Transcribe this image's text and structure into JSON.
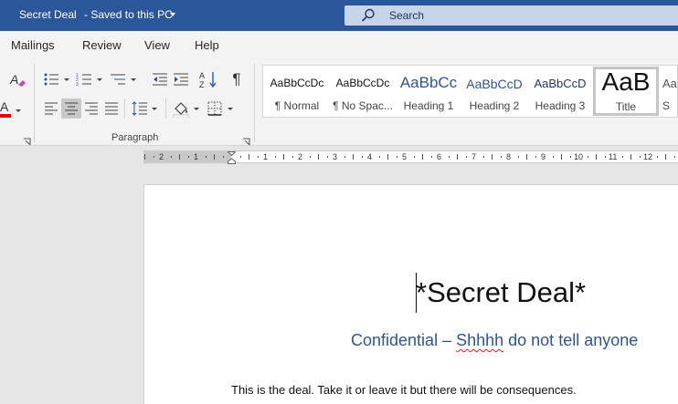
{
  "titlebar": {
    "doc_name": "Secret Deal",
    "save_status": "Saved to this PC",
    "search_label": "Search"
  },
  "tabs": [
    "Mailings",
    "Review",
    "View",
    "Help"
  ],
  "ribbon": {
    "paragraph_label": "Paragraph",
    "show_marks_glyph": "¶"
  },
  "styles": [
    {
      "preview": "AaBbCcDc",
      "name": "¶ Normal"
    },
    {
      "preview": "AaBbCcDc",
      "name": "¶ No Spac..."
    },
    {
      "preview": "AaBbCc",
      "name": "Heading 1"
    },
    {
      "preview": "AaBbCcD",
      "name": "Heading 2"
    },
    {
      "preview": "AaBbCcD",
      "name": "Heading 3"
    },
    {
      "preview": "AaB",
      "name": "Title"
    },
    {
      "preview": "Aa",
      "name": "S"
    }
  ],
  "ruler": {
    "labels": [
      "2",
      "1",
      "1",
      "2",
      "3",
      "4",
      "5",
      "6",
      "7",
      "8",
      "9",
      "10",
      "11",
      "12"
    ]
  },
  "document": {
    "title": "*Secret Deal*",
    "subtitle_before": "Confidential – ",
    "subtitle_misspelled": "Shhhh",
    "subtitle_after": " do not tell anyone",
    "body": "This is the deal. Take it or leave it but there will be consequences."
  },
  "colors": {
    "titlebar": "#2b579a",
    "heading_blue": "#2f5496",
    "font_color_bar": "#e00000"
  }
}
